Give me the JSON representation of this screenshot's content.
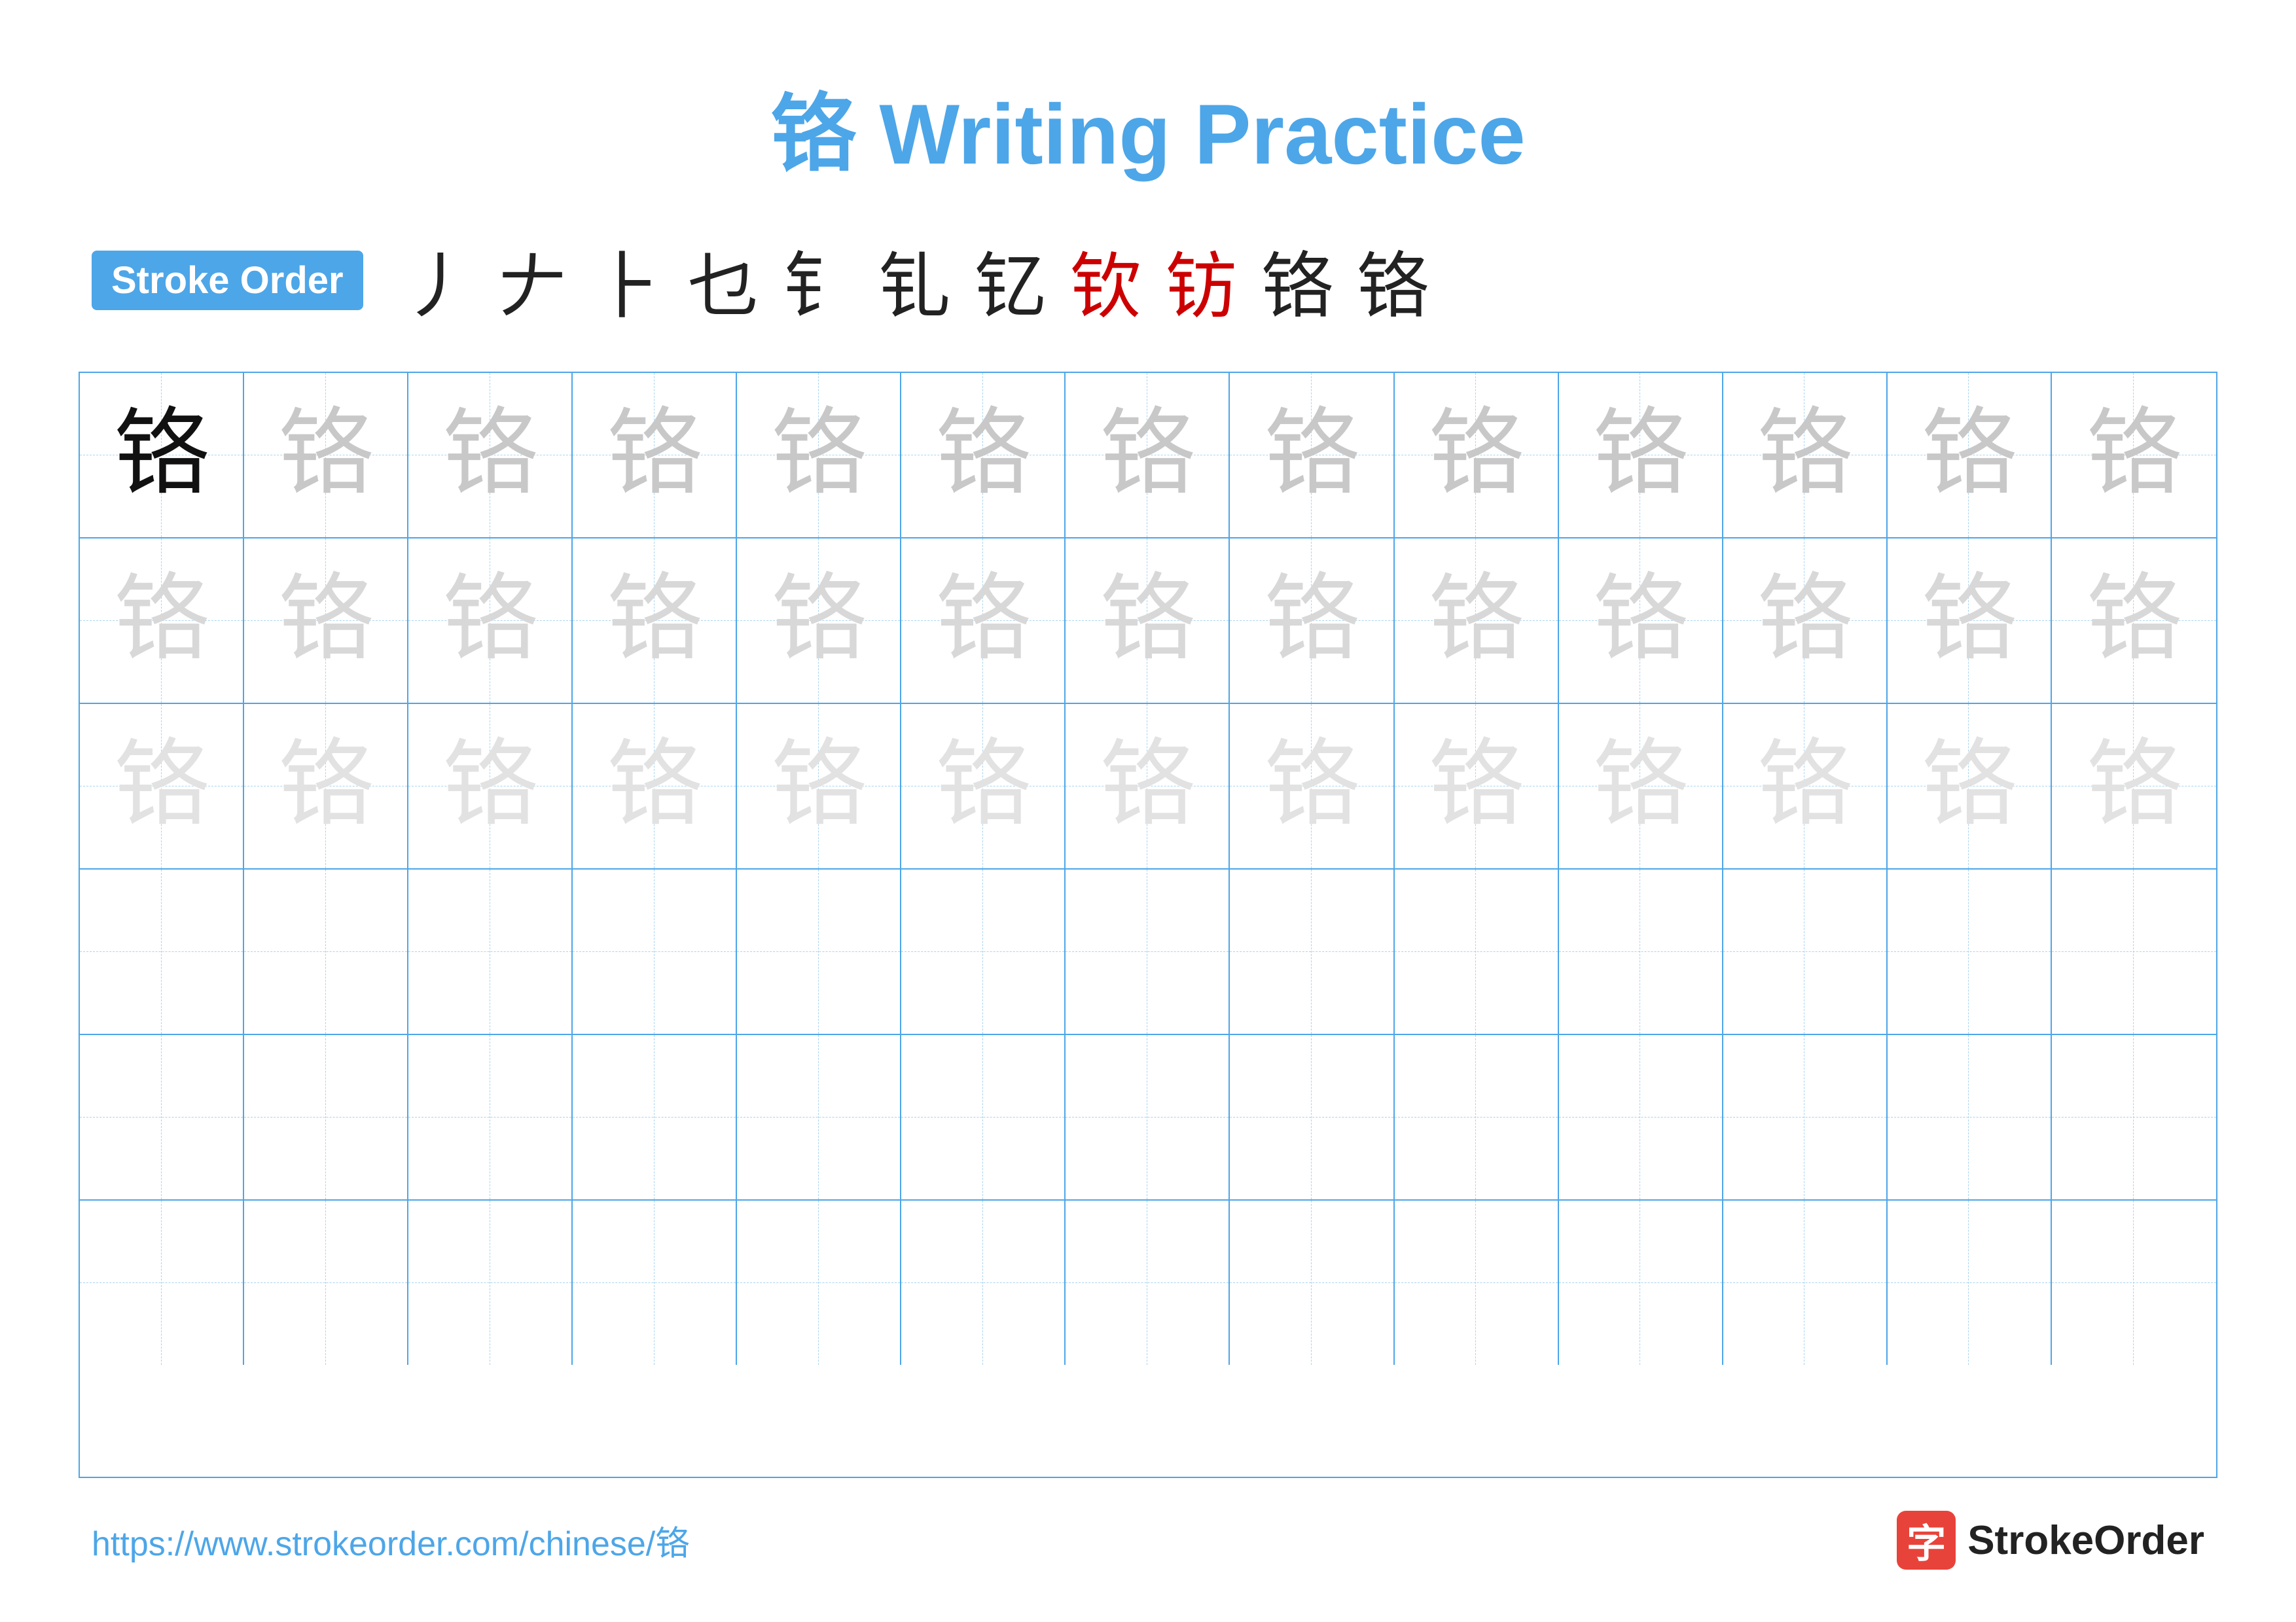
{
  "title": "铬 Writing Practice",
  "stroke_order": {
    "badge_label": "Stroke Order",
    "strokes": [
      "丿",
      "𠂇",
      "⺊",
      "乜",
      "乜̃",
      "钅̃",
      "钆̃",
      "钦̃",
      "钫̃",
      "铬̃",
      "铬"
    ]
  },
  "character": "铬",
  "grid": {
    "rows": 6,
    "cols": 13
  },
  "footer": {
    "url": "https://www.strokeorder.com/chinese/铬",
    "logo_text": "StrokeOrder",
    "logo_char": "字"
  }
}
